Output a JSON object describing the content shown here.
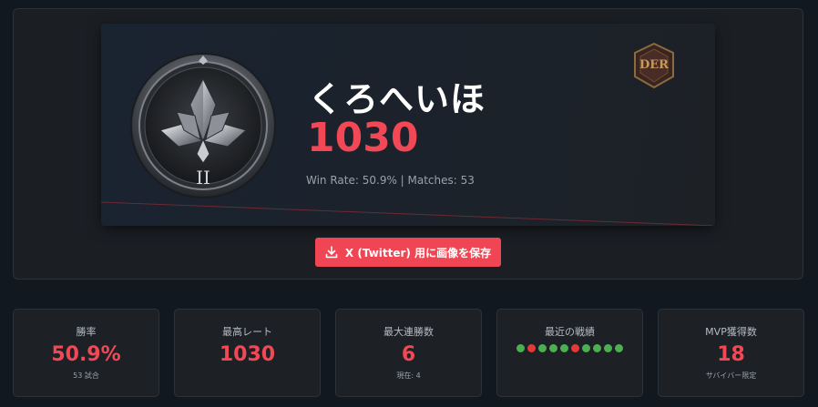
{
  "profile": {
    "player_name": "くろへいほ",
    "rating": "1030",
    "stats_line": "Win Rate: 50.9% | Matches: 53",
    "rank_numeral": "II",
    "logo_text": "DER",
    "emblem_icon": "silver-rank-emblem-icon",
    "logo_icon": "der-logo-icon"
  },
  "save_button": {
    "label": "X (Twitter) 用に画像を保存",
    "icon": "download-icon"
  },
  "stats": {
    "win_rate": {
      "label": "勝率",
      "value": "50.9%",
      "sub": "53 試合"
    },
    "max_rating": {
      "label": "最高レート",
      "value": "1030"
    },
    "max_streak": {
      "label": "最大連勝数",
      "value": "6",
      "sub": "現在: 4"
    },
    "recent": {
      "label": "最近の戦績",
      "results": [
        "win",
        "loss",
        "win",
        "win",
        "win",
        "loss",
        "win",
        "win",
        "win",
        "win"
      ]
    },
    "mvp": {
      "label": "MVP獲得数",
      "value": "18",
      "sub": "サバイバー限定"
    }
  },
  "colors": {
    "accent": "#f24856",
    "win": "#4caf50",
    "loss": "#e53935",
    "background": "#121820"
  }
}
